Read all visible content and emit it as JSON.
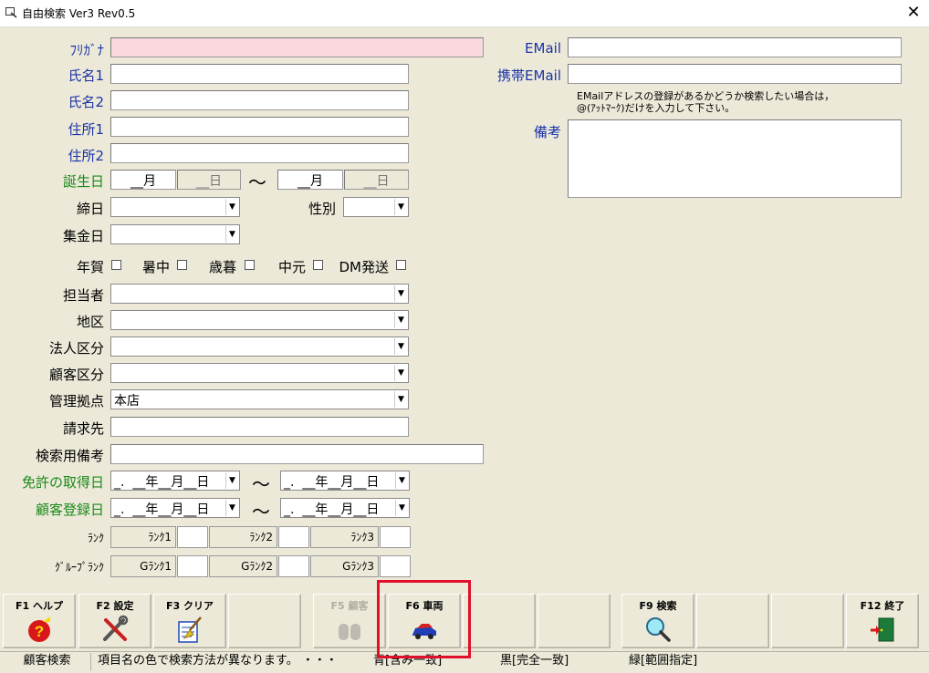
{
  "window": {
    "title": "自由検索 Ver3 Rev0.5",
    "close_glyph": "✕"
  },
  "form": {
    "furigana_label": "ﾌﾘｶﾞﾅ",
    "name1_label": "氏名1",
    "name2_label": "氏名2",
    "address1_label": "住所1",
    "address2_label": "住所2",
    "birthday_label": "誕生日",
    "birthday_from_month": "__月",
    "birthday_from_day": "__日",
    "birthday_to_month": "__月",
    "birthday_to_day": "__日",
    "tilde": "～",
    "closing_day_label": "締日",
    "gender_label": "性別",
    "collection_day_label": "集金日",
    "greeting_new_year": "年賀",
    "greeting_summer": "暑中",
    "greeting_year_end": "歳暮",
    "greeting_midyear": "中元",
    "greeting_dm": "DM発送",
    "staff_label": "担当者",
    "region_label": "地区",
    "corp_class_label": "法人区分",
    "customer_class_label": "顧客区分",
    "base_label": "管理拠点",
    "base_value": "本店",
    "billing_label": "請求先",
    "search_memo_label": "検索用備考",
    "license_label": "免許の取得日",
    "license_from": "_.  __年__月__日",
    "license_to": "_.  __年__月__日",
    "registered_label": "顧客登録日",
    "registered_from": "_.  __年__月__日",
    "registered_to": "_.  __年__月__日",
    "rank_label": "ﾗﾝｸ",
    "rank1": "ﾗﾝｸ1",
    "rank2": "ﾗﾝｸ2",
    "rank3": "ﾗﾝｸ3",
    "group_rank_label": "ｸﾞﾙｰﾌﾟﾗﾝｸ",
    "grank1": "Gﾗﾝｸ1",
    "grank2": "Gﾗﾝｸ2",
    "grank3": "Gﾗﾝｸ3",
    "email_label": "EMail",
    "mobile_email_label": "携帯EMail",
    "email_hint_1": "EMailアドレスの登録があるかどうか検索したい場合は，",
    "email_hint_2": "@(ｱｯﾄﾏｰｸ)だけを入力して下さい。",
    "memo_label": "備考"
  },
  "fkeys": {
    "f1": "F1 ヘルプ",
    "f2": "F2 設定",
    "f3": "F3 クリア",
    "f5": "F5 顧客",
    "f6": "F6 車両",
    "f9": "F9 検索",
    "f12": "F12 終了"
  },
  "status": {
    "mode": "顧客検索",
    "hint": "項目名の色で検索方法が異なります。 ・・・",
    "blue": "青[含み一致]",
    "black": "黒[完全一致]",
    "green": "緑[範囲指定]"
  },
  "colors": {
    "label_blue": "#1a33a8",
    "label_green": "#1a8a1a",
    "furigana_bg": "#f9d9dd",
    "highlight": "#e0102a"
  }
}
